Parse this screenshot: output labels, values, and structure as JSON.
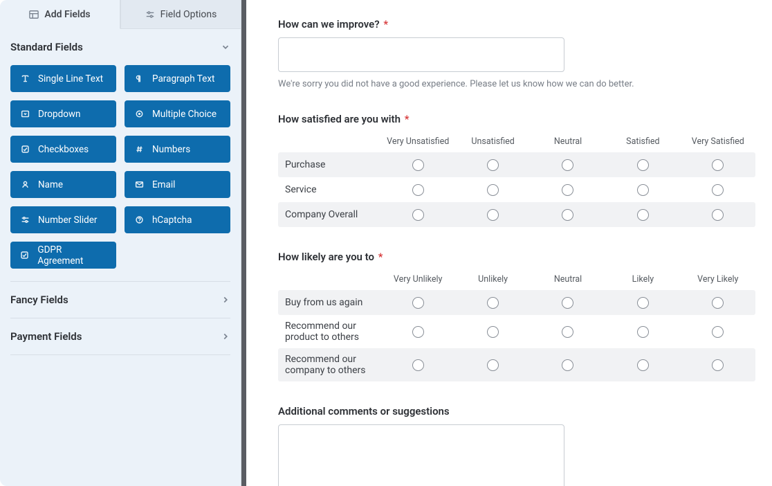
{
  "tabs": {
    "add_fields": "Add Fields",
    "field_options": "Field Options"
  },
  "sections": {
    "standard": "Standard Fields",
    "fancy": "Fancy Fields",
    "payment": "Payment Fields"
  },
  "standard_fields": [
    {
      "label": "Single Line Text",
      "icon": "text"
    },
    {
      "label": "Paragraph Text",
      "icon": "pilcrow"
    },
    {
      "label": "Dropdown",
      "icon": "dropdown"
    },
    {
      "label": "Multiple Choice",
      "icon": "radio-dot"
    },
    {
      "label": "Checkboxes",
      "icon": "check"
    },
    {
      "label": "Numbers",
      "icon": "hash"
    },
    {
      "label": "Name",
      "icon": "user"
    },
    {
      "label": "Email",
      "icon": "mail"
    },
    {
      "label": "Number Slider",
      "icon": "sliders"
    },
    {
      "label": "hCaptcha",
      "icon": "question"
    },
    {
      "label": "GDPR Agreement",
      "icon": "check"
    }
  ],
  "form": {
    "improve": {
      "label": "How can we improve?",
      "helper": "We're sorry you did not have a good experience. Please let us know how we can do better."
    },
    "satisfied": {
      "label": "How satisfied are you with",
      "columns": [
        "Very Unsatisfied",
        "Unsatisfied",
        "Neutral",
        "Satisfied",
        "Very Satisfied"
      ],
      "rows": [
        "Purchase",
        "Service",
        "Company Overall"
      ]
    },
    "likely": {
      "label": "How likely are you to",
      "columns": [
        "Very Unlikely",
        "Unlikely",
        "Neutral",
        "Likely",
        "Very Likely"
      ],
      "rows": [
        "Buy from us again",
        "Recommend our product to others",
        "Recommend our company to others"
      ]
    },
    "comments": {
      "label": "Additional comments or suggestions"
    }
  },
  "required_marker": "*"
}
